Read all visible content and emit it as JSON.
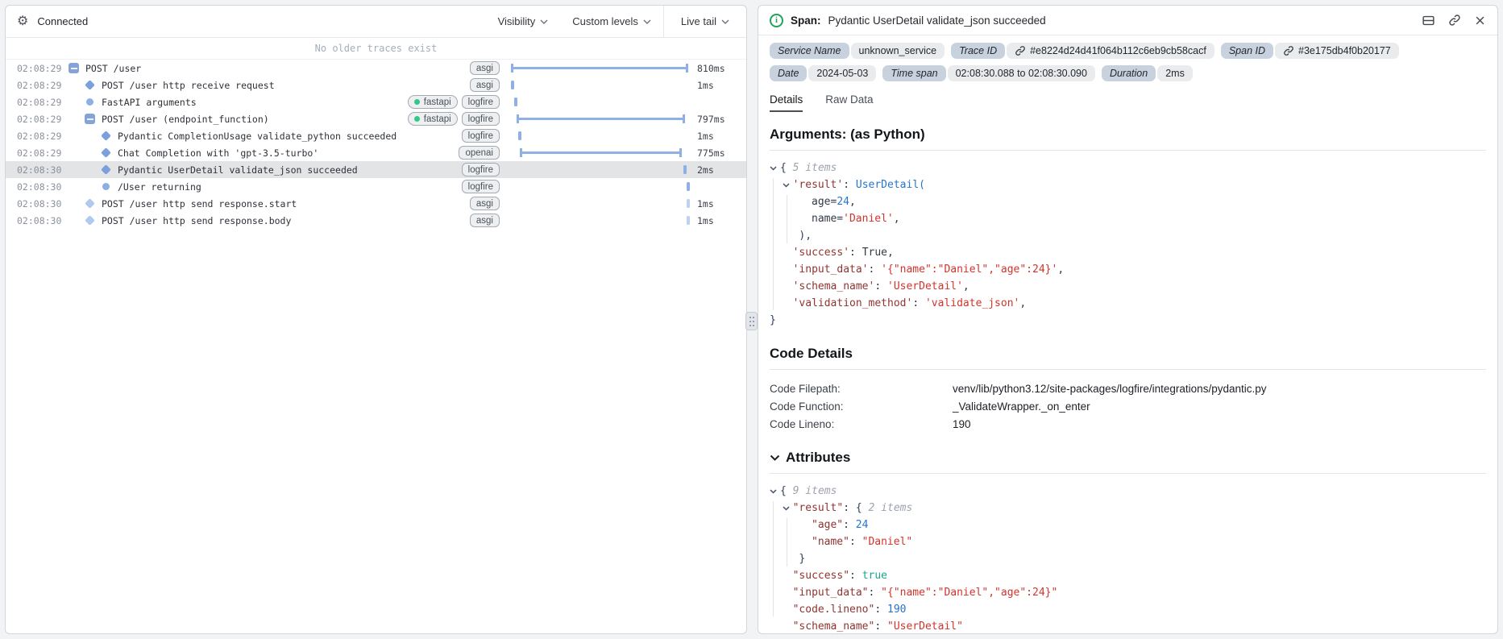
{
  "left_panel": {
    "connected_label": "Connected",
    "toolbar": {
      "visibility_label": "Visibility",
      "custom_levels_label": "Custom levels",
      "live_tail_label": "Live tail"
    },
    "no_older_label": "No older traces exist",
    "trace_rows": [
      {
        "time": "02:08:29",
        "level": 0,
        "marker": "collapse",
        "label": "POST /user",
        "tags": [
          {
            "label": "asgi",
            "dot": false
          }
        ],
        "duration": "810ms",
        "bar": {
          "kind": "span",
          "s": 1,
          "e": 99,
          "light": false
        },
        "selected": false
      },
      {
        "time": "02:08:29",
        "level": 1,
        "marker": "diamond",
        "label": "POST /user http receive request",
        "tags": [
          {
            "label": "asgi",
            "dot": false
          }
        ],
        "duration": "1ms",
        "bar": {
          "kind": "tick",
          "s": 1,
          "light": false
        },
        "selected": false
      },
      {
        "time": "02:08:29",
        "level": 1,
        "marker": "circle",
        "label": "FastAPI arguments",
        "tags": [
          {
            "label": "fastapi",
            "dot": true
          },
          {
            "label": "logfire",
            "dot": false
          }
        ],
        "duration": "",
        "bar": {
          "kind": "tick",
          "s": 2.5,
          "light": false
        },
        "selected": false
      },
      {
        "time": "02:08:29",
        "level": 1,
        "marker": "collapse",
        "label": "POST /user (endpoint_function)",
        "tags": [
          {
            "label": "fastapi",
            "dot": true
          },
          {
            "label": "logfire",
            "dot": false
          }
        ],
        "duration": "797ms",
        "bar": {
          "kind": "span",
          "s": 4,
          "e": 97.5,
          "light": false
        },
        "selected": false
      },
      {
        "time": "02:08:29",
        "level": 2,
        "marker": "diamond",
        "label": "Pydantic CompletionUsage validate_python succeeded",
        "tags": [
          {
            "label": "logfire",
            "dot": false
          }
        ],
        "duration": "1ms",
        "bar": {
          "kind": "tick",
          "s": 5,
          "light": false
        },
        "selected": false
      },
      {
        "time": "02:08:29",
        "level": 2,
        "marker": "diamond",
        "label": "Chat Completion with 'gpt-3.5-turbo'",
        "tags": [
          {
            "label": "openai",
            "dot": false
          }
        ],
        "duration": "775ms",
        "bar": {
          "kind": "span",
          "s": 6,
          "e": 95.5,
          "light": false
        },
        "selected": false
      },
      {
        "time": "02:08:30",
        "level": 2,
        "marker": "diamond",
        "label": "Pydantic UserDetail validate_json succeeded",
        "tags": [
          {
            "label": "logfire",
            "dot": false
          }
        ],
        "duration": "2ms",
        "bar": {
          "kind": "tick",
          "s": 96.5,
          "light": false
        },
        "selected": true
      },
      {
        "time": "02:08:30",
        "level": 2,
        "marker": "circle",
        "label": "/User returning",
        "tags": [
          {
            "label": "logfire",
            "dot": false
          }
        ],
        "duration": "",
        "bar": {
          "kind": "tick",
          "s": 98,
          "light": false
        },
        "selected": false
      },
      {
        "time": "02:08:30",
        "level": 1,
        "marker": "diamond-light",
        "label": "POST /user http send response.start",
        "tags": [
          {
            "label": "asgi",
            "dot": false
          }
        ],
        "duration": "1ms",
        "bar": {
          "kind": "tick",
          "s": 98,
          "light": true
        },
        "selected": false
      },
      {
        "time": "02:08:30",
        "level": 1,
        "marker": "diamond-light",
        "label": "POST /user http send response.body",
        "tags": [
          {
            "label": "asgi",
            "dot": false
          }
        ],
        "duration": "1ms",
        "bar": {
          "kind": "tick",
          "s": 98,
          "light": true
        },
        "selected": false
      }
    ]
  },
  "right_panel": {
    "header": {
      "kind_label": "Span:",
      "title": "Pydantic UserDetail validate_json succeeded"
    },
    "badges": [
      {
        "label": "Service Name",
        "value": "unknown_service",
        "link": false
      },
      {
        "label": "Trace ID",
        "value": "#e8224d24d41f064b112c6eb9cb58cacf",
        "link": true
      },
      {
        "label": "Span ID",
        "value": "#3e175db4f0b20177",
        "link": true
      },
      {
        "label": "Date",
        "value": "2024-05-03",
        "link": false
      },
      {
        "label": "Time span",
        "value": "02:08:30.088 to 02:08:30.090",
        "link": false
      },
      {
        "label": "Duration",
        "value": "2ms",
        "link": false
      }
    ],
    "tabs": [
      {
        "label": "Details",
        "active": true
      },
      {
        "label": "Raw Data",
        "active": false
      }
    ],
    "arguments_section": {
      "heading": "Arguments: (as Python)",
      "lines": [
        {
          "ind": 0,
          "chev": true,
          "seg": [
            [
              "{",
              "br"
            ],
            [
              " 5 items",
              "i"
            ]
          ]
        },
        {
          "ind": 2,
          "chev": true,
          "seg": [
            [
              "'result'",
              "k"
            ],
            [
              ": ",
              "p"
            ],
            [
              "UserDetail(",
              "b"
            ]
          ]
        },
        {
          "ind": 5,
          "chev": false,
          "seg": [
            [
              "age=",
              "p"
            ],
            [
              "24",
              "n"
            ],
            [
              ",",
              "p"
            ]
          ]
        },
        {
          "ind": 5,
          "chev": false,
          "seg": [
            [
              "name=",
              "p"
            ],
            [
              "'Daniel'",
              "s"
            ],
            [
              ",",
              "p"
            ]
          ]
        },
        {
          "ind": 3,
          "chev": false,
          "seg": [
            [
              "),",
              "br"
            ]
          ]
        },
        {
          "ind": 2,
          "chev": false,
          "seg": [
            [
              "'success'",
              "k"
            ],
            [
              ": ",
              "p"
            ],
            [
              "True",
              "bp"
            ],
            [
              ",",
              "p"
            ]
          ]
        },
        {
          "ind": 2,
          "chev": false,
          "seg": [
            [
              "'input_data'",
              "k"
            ],
            [
              ": ",
              "p"
            ],
            [
              "'{\"name\":\"Daniel\",\"age\":24}'",
              "s"
            ],
            [
              ",",
              "p"
            ]
          ]
        },
        {
          "ind": 2,
          "chev": false,
          "seg": [
            [
              "'schema_name'",
              "k"
            ],
            [
              ": ",
              "p"
            ],
            [
              "'UserDetail'",
              "s"
            ],
            [
              ",",
              "p"
            ]
          ]
        },
        {
          "ind": 2,
          "chev": false,
          "seg": [
            [
              "'validation_method'",
              "k"
            ],
            [
              ": ",
              "p"
            ],
            [
              "'validate_json'",
              "s"
            ],
            [
              ",",
              "p"
            ]
          ]
        },
        {
          "ind": 0,
          "chev": false,
          "seg": [
            [
              "}",
              "br"
            ]
          ]
        }
      ]
    },
    "code_details": {
      "heading": "Code Details",
      "rows": [
        {
          "label": "Code Filepath:",
          "value": "venv/lib/python3.12/site-packages/logfire/integrations/pydantic.py"
        },
        {
          "label": "Code Function:",
          "value": "_ValidateWrapper._on_enter"
        },
        {
          "label": "Code Lineno:",
          "value": "190"
        }
      ]
    },
    "attributes_section": {
      "heading": "Attributes",
      "lines": [
        {
          "ind": 0,
          "chev": true,
          "seg": [
            [
              "{",
              "br"
            ],
            [
              " 9 items",
              "i"
            ]
          ]
        },
        {
          "ind": 2,
          "chev": true,
          "seg": [
            [
              "\"result\"",
              "k"
            ],
            [
              ": ",
              "p"
            ],
            [
              "{",
              "br"
            ],
            [
              " 2 items",
              "i"
            ]
          ]
        },
        {
          "ind": 5,
          "chev": false,
          "seg": [
            [
              "\"age\"",
              "k"
            ],
            [
              ": ",
              "p"
            ],
            [
              "24",
              "n"
            ]
          ]
        },
        {
          "ind": 5,
          "chev": false,
          "seg": [
            [
              "\"name\"",
              "k"
            ],
            [
              ": ",
              "p"
            ],
            [
              "\"Daniel\"",
              "s"
            ]
          ]
        },
        {
          "ind": 3,
          "chev": false,
          "seg": [
            [
              "}",
              "br"
            ]
          ]
        },
        {
          "ind": 2,
          "chev": false,
          "seg": [
            [
              "\"success\"",
              "k"
            ],
            [
              ": ",
              "p"
            ],
            [
              "true",
              "bj"
            ]
          ]
        },
        {
          "ind": 2,
          "chev": false,
          "seg": [
            [
              "\"input_data\"",
              "k"
            ],
            [
              ": ",
              "p"
            ],
            [
              "\"{\"name\":\"Daniel\",\"age\":24}\"",
              "s"
            ]
          ]
        },
        {
          "ind": 2,
          "chev": false,
          "seg": [
            [
              "\"code.lineno\"",
              "k"
            ],
            [
              ": ",
              "p"
            ],
            [
              "190",
              "n"
            ]
          ]
        },
        {
          "ind": 2,
          "chev": false,
          "seg": [
            [
              "\"schema_name\"",
              "k"
            ],
            [
              ": ",
              "p"
            ],
            [
              "\"UserDetail\"",
              "s"
            ]
          ]
        }
      ]
    }
  }
}
